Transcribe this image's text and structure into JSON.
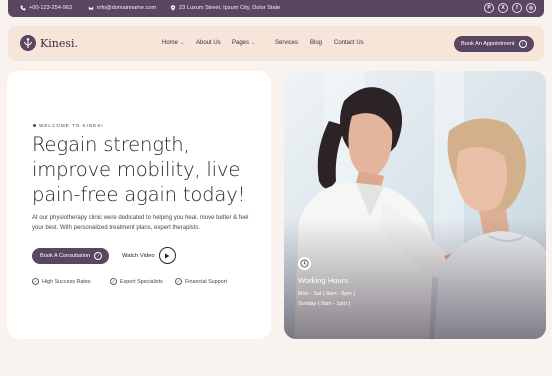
{
  "topbar": {
    "phone": "+00-123-254-963",
    "email": "info@domainname.com",
    "address": "23 Luxum Street, Ipsum City, Dolor State",
    "socials": [
      {
        "icon": "pinterest-icon",
        "glyph": "P"
      },
      {
        "icon": "x-icon",
        "glyph": "X"
      },
      {
        "icon": "facebook-icon",
        "glyph": "f"
      },
      {
        "icon": "instagram-icon",
        "glyph": "◎"
      }
    ]
  },
  "nav": {
    "brand": "Kinesi.",
    "items": [
      {
        "label": "Home",
        "chevron": "⌄"
      },
      {
        "label": "About Us",
        "chevron": ""
      },
      {
        "label": "Pages",
        "chevron": "⌄"
      },
      {
        "label": "Services",
        "chevron": ""
      },
      {
        "label": "Blog",
        "chevron": ""
      },
      {
        "label": "Contact Us",
        "chevron": ""
      }
    ],
    "cta": "Book An Appointment"
  },
  "hero": {
    "eyebrow": "WELCOME TO KINESI",
    "headline_lines": [
      "Regain strength,",
      "improve mobility, live",
      "pain-free again today!"
    ],
    "paragraph": "At our physiotherapy clinic were dedicated to helping you heal, move better & feel your best. With personalized treatment plans, expert therapists.",
    "primary_button": "Book A Consultation",
    "video_label": "Watch Video",
    "features": [
      "High Success Rates",
      "Expert Specialists",
      "Financial Support"
    ]
  },
  "hours": {
    "title": "Working Hours",
    "lines": [
      "Mon - Sat ( 8am - 5pm )",
      "Sunday ( 8am - 1pm )"
    ]
  },
  "colors": {
    "brand": "#5b4661",
    "nav_bg": "#f8e5da",
    "page_bg": "#f8f3ef"
  }
}
